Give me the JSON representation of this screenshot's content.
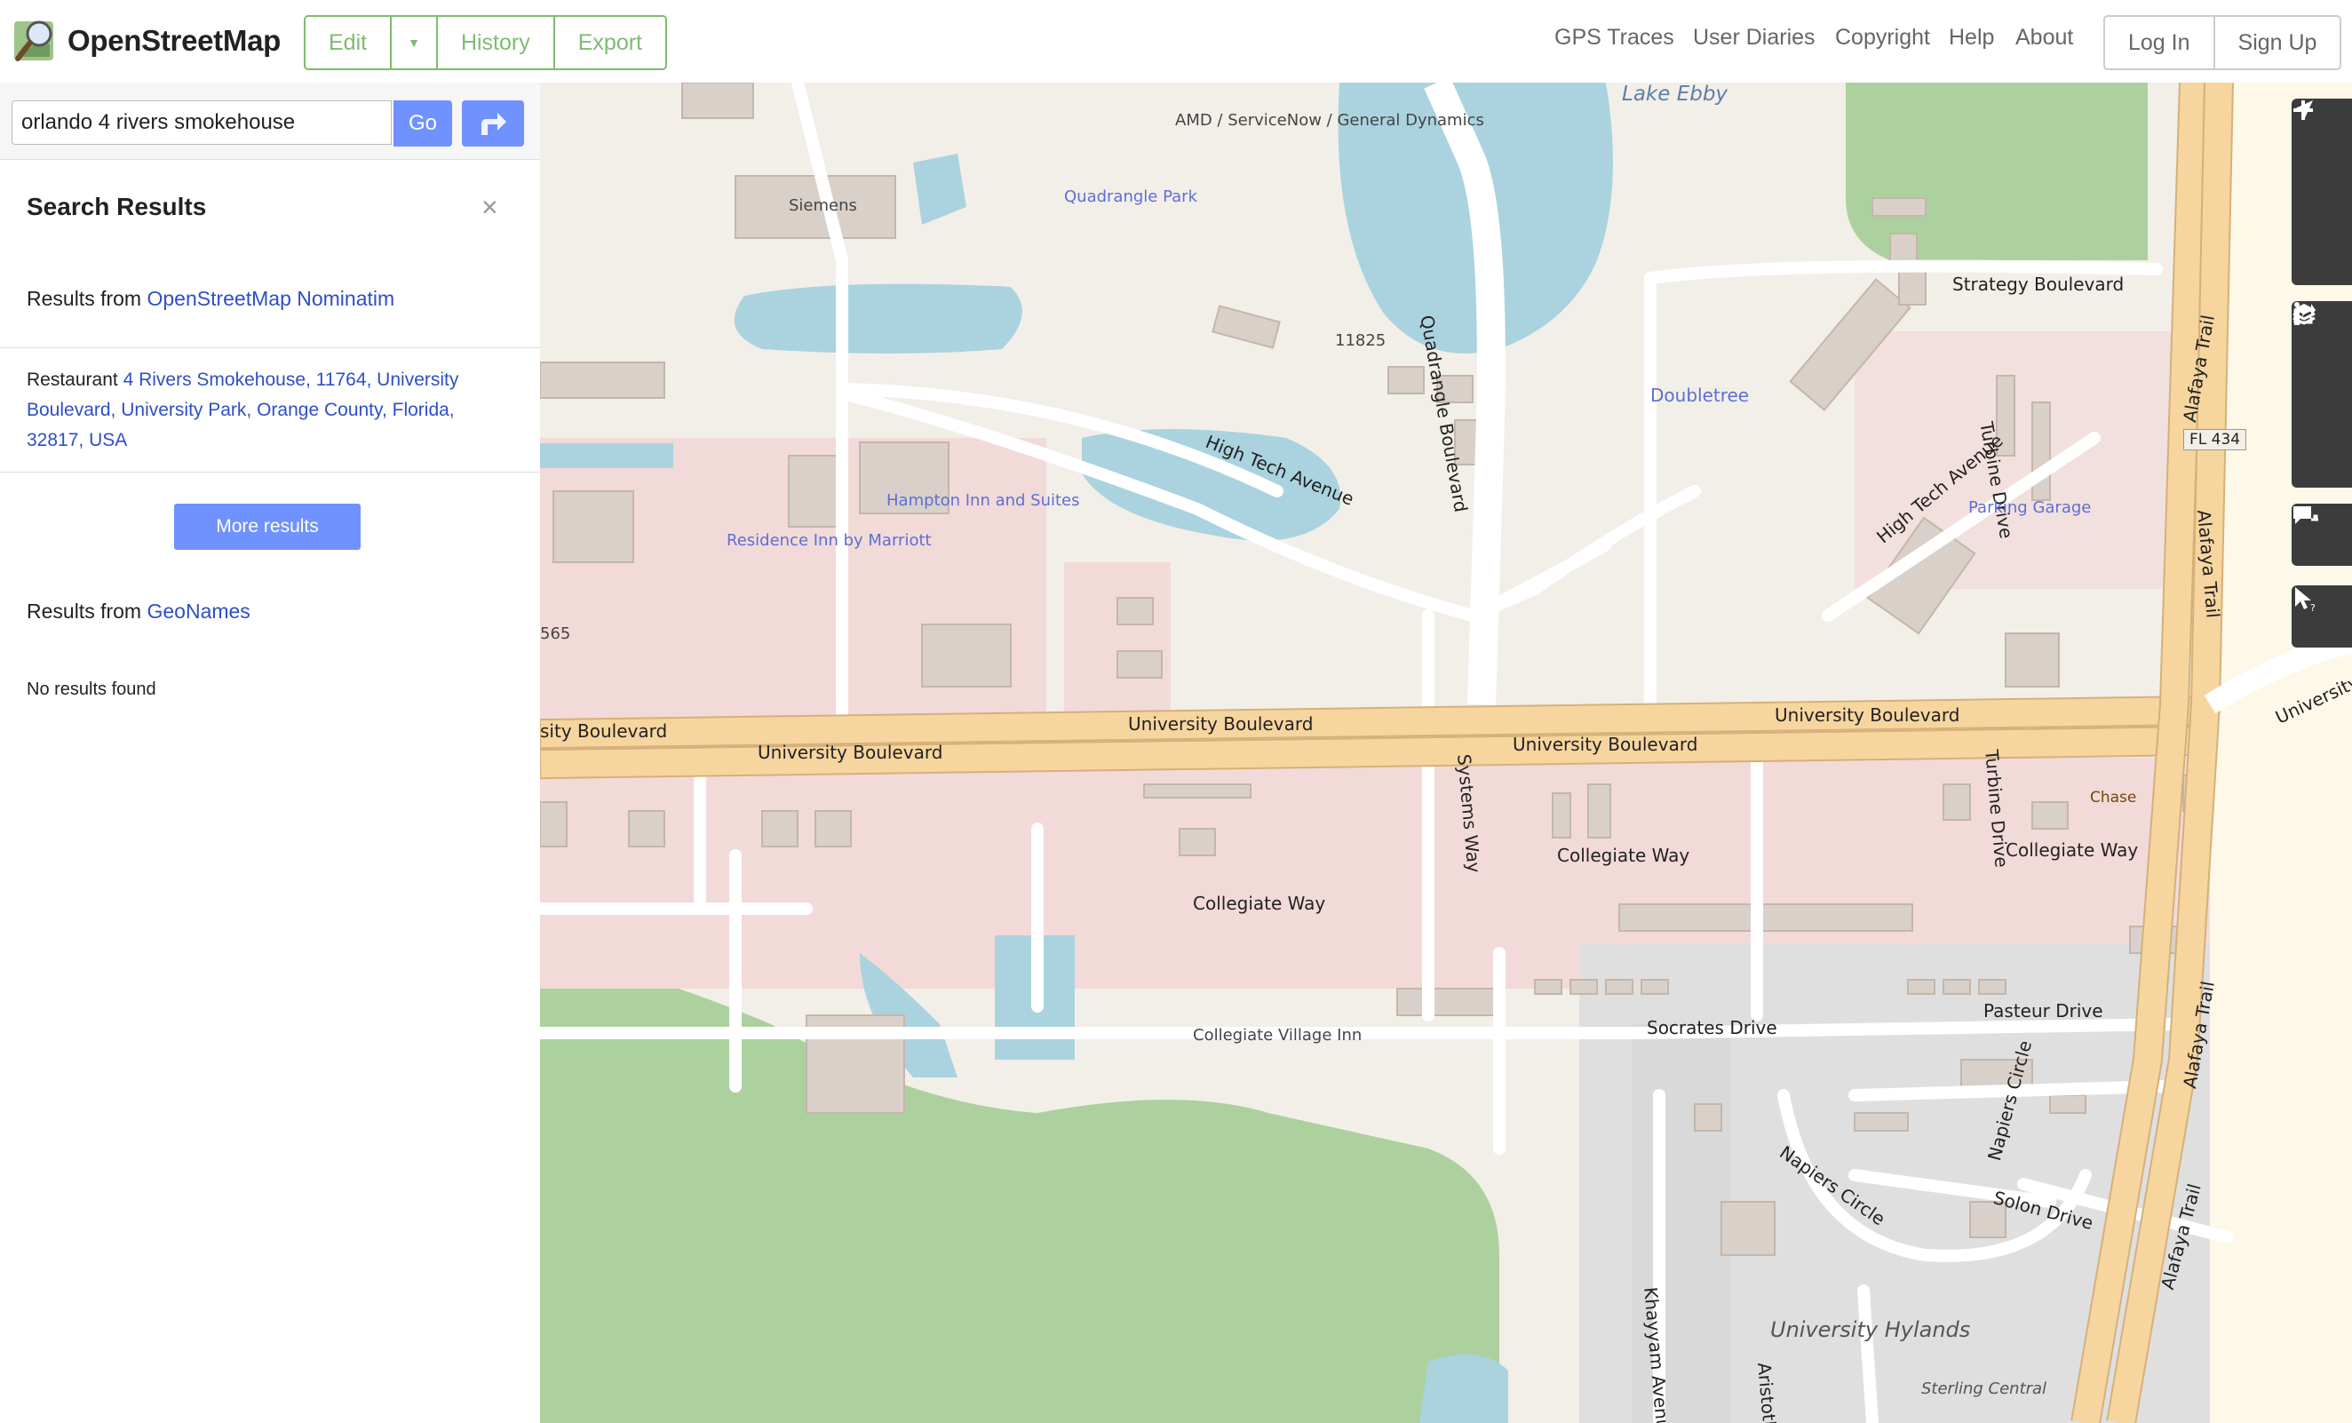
{
  "header": {
    "brand": "OpenStreetMap",
    "edit_label": "Edit",
    "history_label": "History",
    "export_label": "Export",
    "nav": [
      "GPS Traces",
      "User Diaries",
      "Copyright",
      "Help",
      "About"
    ],
    "login_label": "Log In",
    "signup_label": "Sign Up",
    "accent_color": "#7ebc6f"
  },
  "search": {
    "value": "orlando 4 rivers smokehouse",
    "go_label": "Go"
  },
  "results": {
    "title": "Search Results",
    "close_icon": "close-icon",
    "nominatim": {
      "prefix": "Results from ",
      "source": "OpenStreetMap Nominatim"
    },
    "item": {
      "type": "Restaurant",
      "link": "4 Rivers Smokehouse, 11764, University Boulevard, University Park, Orange County, Florida, 32817, USA"
    },
    "more_label": "More results",
    "geonames": {
      "prefix": "Results from ",
      "source": "GeoNames"
    },
    "no_results": "No results found"
  },
  "map": {
    "labels": {
      "lake_ebby": "Lake Ebby",
      "amd": "AMD / ServiceNow / General Dynamics",
      "siemens": "Siemens",
      "quadrangle_park": "Quadrangle Park",
      "quadrangle_blvd": "Quadrangle Boulevard",
      "addr_11825": "11825",
      "high_tech_ave": "High Tech Avenue",
      "doubletree": "Doubletree",
      "strategy_blvd": "Strategy Boulevard",
      "turbine_drive": "Turbine Drive",
      "parking_garage": "Parking Garage",
      "alafaya_trail": "Alafaya Trail",
      "fl434": "FL 434",
      "residence_inn": "Residence Inn by Marriott",
      "hampton_inn": "Hampton Inn and Suites",
      "addr_565": "565",
      "university_blvd": "University Boulevard",
      "university_blvd_left": "sity Boulevard",
      "systems_way": "Systems Way",
      "collegiate_way": "Collegiate Way",
      "chase": "Chase",
      "collegiate_village_inn": "Collegiate Village Inn",
      "socrates_drive": "Socrates Drive",
      "pasteur_drive": "Pasteur Drive",
      "napiers_circle": "Napiers Circle",
      "solon_drive": "Solon Drive",
      "khayyam_avenue": "Khayyam Avenue",
      "aristotle": "Aristotle",
      "university_hylands": "University Hylands",
      "sterling_central": "Sterling Central",
      "university_right": "University B"
    }
  },
  "controls": [
    "zoom-in-icon",
    "zoom-out-icon",
    "locate-icon",
    "layers-icon",
    "info-icon",
    "share-icon",
    "note-icon",
    "query-icon"
  ]
}
